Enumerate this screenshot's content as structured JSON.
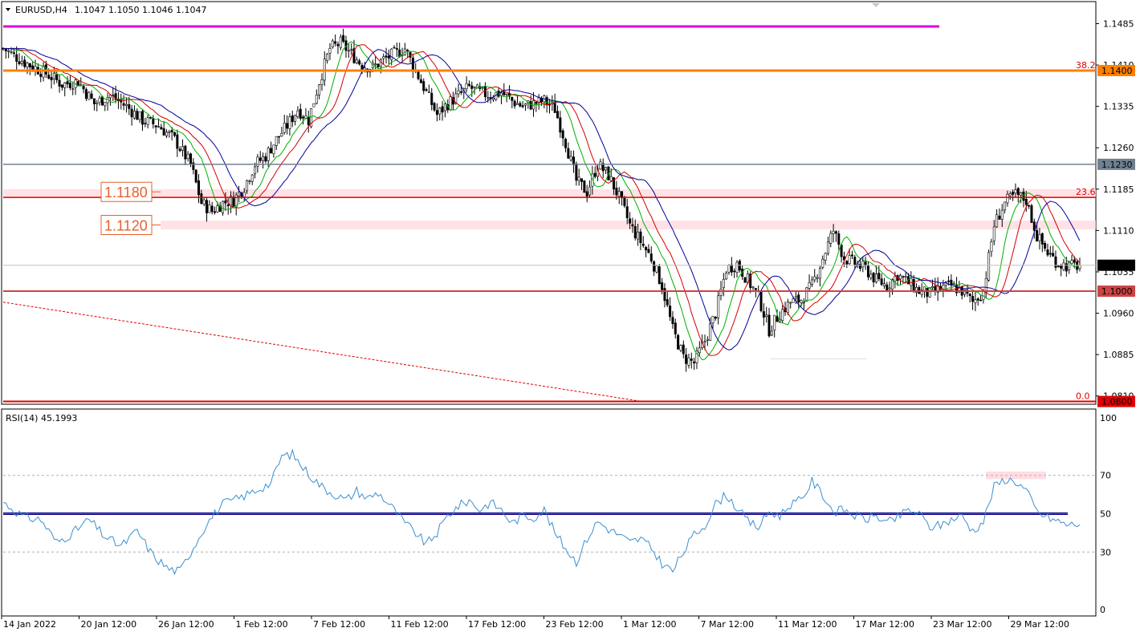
{
  "header": {
    "symbol": "EURUSD,H4",
    "ohlc": "1.1047 1.1050 1.1046 1.1047"
  },
  "rsi_header": "RSI(14) 45.1993",
  "colors": {
    "bull": "#ffffff",
    "bear": "#000000",
    "ma_fast": "#00b000",
    "ma_mid": "#d40000",
    "ma_slow": "#000099",
    "rsi": "#3a8fd0",
    "resistance_top": "#e000e0",
    "level_1400": "#ff7f00",
    "level_red": "#e00000",
    "level_gray": "#708090",
    "zone_pink": "#ffd6dc"
  },
  "chart_data": [
    {
      "type": "candlestick",
      "symbol": "EURUSD",
      "timeframe": "H4",
      "title": "EURUSD,H4",
      "ylim": [
        1.0795,
        1.1525
      ],
      "y_ticks": [
        "1.1485",
        "1.1410",
        "1.1335",
        "1.1260",
        "1.1185",
        "1.1110",
        "1.1035",
        "1.0960",
        "1.0885",
        "1.0810"
      ],
      "x_ticks": [
        "14 Jan 2022",
        "20 Jan 12:00",
        "26 Jan 12:00",
        "1 Feb 12:00",
        "7 Feb 12:00",
        "11 Feb 12:00",
        "17 Feb 12:00",
        "23 Feb 12:00",
        "1 Mar 12:00",
        "7 Mar 12:00",
        "11 Mar 12:00",
        "17 Mar 12:00",
        "23 Mar 12:00",
        "29 Mar 12:00"
      ],
      "current_price": "1.1047",
      "level_labels": [
        {
          "value": 1.14,
          "text": "1.1400",
          "fib": "38.2",
          "color": "#ff7f00"
        },
        {
          "value": 1.123,
          "text": "1.1230",
          "fib": "",
          "color": "#708090"
        },
        {
          "value": 1.117,
          "text": "",
          "fib": "23.6",
          "color": "#e00000"
        },
        {
          "value": 1.1,
          "text": "1.1000",
          "fib": "",
          "color": "#cc4444"
        },
        {
          "value": 1.08,
          "text": "1.0800",
          "fib": "0.0",
          "color": "#e00000"
        }
      ],
      "annotations": [
        "1.1180",
        "1.1120"
      ],
      "resistance_line": 1.148,
      "close_path": [
        [
          0,
          1.144
        ],
        [
          8,
          1.1415
        ],
        [
          16,
          1.1395
        ],
        [
          22,
          1.1375
        ],
        [
          28,
          1.138
        ],
        [
          34,
          1.134
        ],
        [
          40,
          1.1355
        ],
        [
          46,
          1.1335
        ],
        [
          52,
          1.131
        ],
        [
          58,
          1.13
        ],
        [
          64,
          1.1275
        ],
        [
          70,
          1.123
        ],
        [
          74,
          1.116
        ],
        [
          78,
          1.1145
        ],
        [
          82,
          1.116
        ],
        [
          86,
          1.1165
        ],
        [
          90,
          1.119
        ],
        [
          94,
          1.123
        ],
        [
          98,
          1.1245
        ],
        [
          102,
          1.1275
        ],
        [
          106,
          1.13
        ],
        [
          110,
          1.133
        ],
        [
          114,
          1.131
        ],
        [
          118,
          1.138
        ],
        [
          122,
          1.144
        ],
        [
          126,
          1.145
        ],
        [
          130,
          1.143
        ],
        [
          134,
          1.141
        ],
        [
          138,
          1.1405
        ],
        [
          142,
          1.142
        ],
        [
          146,
          1.143
        ],
        [
          150,
          1.144
        ],
        [
          154,
          1.14
        ],
        [
          158,
          1.136
        ],
        [
          162,
          1.132
        ],
        [
          166,
          1.134
        ],
        [
          170,
          1.1355
        ],
        [
          174,
          1.137
        ],
        [
          178,
          1.136
        ],
        [
          182,
          1.1355
        ],
        [
          186,
          1.136
        ],
        [
          190,
          1.1345
        ],
        [
          194,
          1.1335
        ],
        [
          198,
          1.134
        ],
        [
          202,
          1.1345
        ],
        [
          206,
          1.133
        ],
        [
          210,
          1.127
        ],
        [
          214,
          1.12
        ],
        [
          218,
          1.118
        ],
        [
          222,
          1.123
        ],
        [
          226,
          1.121
        ],
        [
          230,
          1.117
        ],
        [
          234,
          1.112
        ],
        [
          238,
          1.109
        ],
        [
          242,
          1.106
        ],
        [
          246,
          1.101
        ],
        [
          250,
          1.093
        ],
        [
          254,
          1.088
        ],
        [
          258,
          1.087
        ],
        [
          262,
          1.091
        ],
        [
          266,
          1.096
        ],
        [
          270,
          1.104
        ],
        [
          274,
          1.105
        ],
        [
          278,
          1.102
        ],
        [
          282,
          1.099
        ],
        [
          286,
          1.093
        ],
        [
          290,
          1.096
        ],
        [
          294,
          1.098
        ],
        [
          298,
          1.0985
        ],
        [
          302,
          1.101
        ],
        [
          306,
          1.106
        ],
        [
          310,
          1.111
        ],
        [
          314,
          1.106
        ],
        [
          318,
          1.105
        ],
        [
          322,
          1.104
        ],
        [
          326,
          1.102
        ],
        [
          330,
          1.101
        ],
        [
          334,
          1.103
        ],
        [
          338,
          1.1015
        ],
        [
          342,
          1.1
        ],
        [
          346,
          1.0995
        ],
        [
          350,
          1.1005
        ],
        [
          354,
          1.101
        ],
        [
          358,
          1.1
        ],
        [
          362,
          1.098
        ],
        [
          366,
          1.1
        ],
        [
          370,
          1.112
        ],
        [
          374,
          1.116
        ],
        [
          378,
          1.1175
        ],
        [
          382,
          1.1165
        ],
        [
          386,
          1.11
        ],
        [
          390,
          1.107
        ],
        [
          394,
          1.105
        ],
        [
          398,
          1.1045
        ],
        [
          402,
          1.1047
        ]
      ]
    },
    {
      "type": "line",
      "title": "RSI(14) 45.1993",
      "ylim": [
        0,
        100
      ],
      "y_ticks": [
        "100",
        "70",
        "50",
        "30",
        "0"
      ],
      "levels": [
        70,
        50,
        30
      ],
      "current_value": 45.1993,
      "rsi_path": [
        [
          0,
          56
        ],
        [
          8,
          48
        ],
        [
          14,
          47
        ],
        [
          20,
          35
        ],
        [
          26,
          40
        ],
        [
          32,
          47
        ],
        [
          38,
          38
        ],
        [
          44,
          33
        ],
        [
          50,
          41
        ],
        [
          56,
          28
        ],
        [
          62,
          21
        ],
        [
          66,
          20
        ],
        [
          70,
          30
        ],
        [
          76,
          45
        ],
        [
          82,
          55
        ],
        [
          88,
          58
        ],
        [
          94,
          62
        ],
        [
          100,
          66
        ],
        [
          104,
          80
        ],
        [
          108,
          81
        ],
        [
          112,
          74
        ],
        [
          116,
          68
        ],
        [
          120,
          63
        ],
        [
          124,
          60
        ],
        [
          128,
          57
        ],
        [
          132,
          62
        ],
        [
          136,
          58
        ],
        [
          140,
          61
        ],
        [
          146,
          52
        ],
        [
          150,
          45
        ],
        [
          154,
          40
        ],
        [
          158,
          34
        ],
        [
          162,
          40
        ],
        [
          166,
          49
        ],
        [
          170,
          54
        ],
        [
          174,
          57
        ],
        [
          178,
          52
        ],
        [
          182,
          56
        ],
        [
          186,
          52
        ],
        [
          190,
          45
        ],
        [
          194,
          49
        ],
        [
          198,
          48
        ],
        [
          202,
          52
        ],
        [
          206,
          40
        ],
        [
          210,
          32
        ],
        [
          214,
          25
        ],
        [
          218,
          37
        ],
        [
          222,
          46
        ],
        [
          226,
          42
        ],
        [
          230,
          39
        ],
        [
          234,
          35
        ],
        [
          238,
          37
        ],
        [
          242,
          32
        ],
        [
          246,
          24
        ],
        [
          250,
          20
        ],
        [
          254,
          30
        ],
        [
          258,
          39
        ],
        [
          262,
          44
        ],
        [
          266,
          55
        ],
        [
          270,
          60
        ],
        [
          274,
          53
        ],
        [
          278,
          46
        ],
        [
          282,
          43
        ],
        [
          286,
          51
        ],
        [
          290,
          49
        ],
        [
          294,
          55
        ],
        [
          298,
          57
        ],
        [
          302,
          67
        ],
        [
          306,
          60
        ],
        [
          310,
          51
        ],
        [
          314,
          52
        ],
        [
          318,
          49
        ],
        [
          322,
          47
        ],
        [
          326,
          49
        ],
        [
          330,
          45
        ],
        [
          334,
          48
        ],
        [
          338,
          52
        ],
        [
          342,
          50
        ],
        [
          346,
          43
        ],
        [
          350,
          44
        ],
        [
          354,
          47
        ],
        [
          358,
          49
        ],
        [
          362,
          41
        ],
        [
          366,
          46
        ],
        [
          370,
          64
        ],
        [
          374,
          68
        ],
        [
          378,
          67
        ],
        [
          382,
          62
        ],
        [
          386,
          51
        ],
        [
          390,
          48
        ],
        [
          394,
          46
        ],
        [
          398,
          44
        ],
        [
          402,
          45
        ]
      ]
    }
  ]
}
